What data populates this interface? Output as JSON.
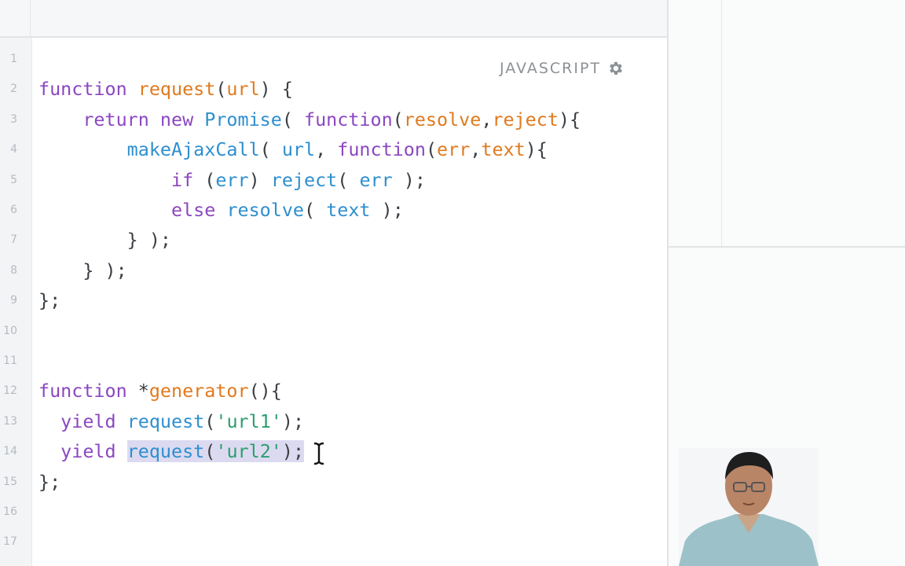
{
  "editor": {
    "language_label": "JAVASCRIPT",
    "settings_icon": "gear-icon",
    "lines": [
      {
        "n": "1",
        "tokens": []
      },
      {
        "n": "2",
        "tokens": [
          {
            "t": "function ",
            "c": "k"
          },
          {
            "t": "request",
            "c": "f"
          },
          {
            "t": "(",
            "c": ""
          },
          {
            "t": "url",
            "c": "f"
          },
          {
            "t": ") {",
            "c": ""
          }
        ]
      },
      {
        "n": "3",
        "tokens": [
          {
            "t": "    return new ",
            "c": "k"
          },
          {
            "t": "Promise",
            "c": "c"
          },
          {
            "t": "( ",
            "c": ""
          },
          {
            "t": "function",
            "c": "k"
          },
          {
            "t": "(",
            "c": ""
          },
          {
            "t": "resolve",
            "c": "f"
          },
          {
            "t": ",",
            "c": ""
          },
          {
            "t": "reject",
            "c": "f"
          },
          {
            "t": "){",
            "c": ""
          }
        ]
      },
      {
        "n": "4",
        "tokens": [
          {
            "t": "        ",
            "c": ""
          },
          {
            "t": "makeAjaxCall",
            "c": "c"
          },
          {
            "t": "( ",
            "c": ""
          },
          {
            "t": "url",
            "c": "c"
          },
          {
            "t": ", ",
            "c": ""
          },
          {
            "t": "function",
            "c": "k"
          },
          {
            "t": "(",
            "c": ""
          },
          {
            "t": "err",
            "c": "f"
          },
          {
            "t": ",",
            "c": ""
          },
          {
            "t": "text",
            "c": "f"
          },
          {
            "t": "){",
            "c": ""
          }
        ]
      },
      {
        "n": "5",
        "tokens": [
          {
            "t": "            ",
            "c": ""
          },
          {
            "t": "if",
            "c": "k"
          },
          {
            "t": " (",
            "c": ""
          },
          {
            "t": "err",
            "c": "c"
          },
          {
            "t": ") ",
            "c": ""
          },
          {
            "t": "reject",
            "c": "c"
          },
          {
            "t": "( ",
            "c": ""
          },
          {
            "t": "err",
            "c": "c"
          },
          {
            "t": " );",
            "c": ""
          }
        ]
      },
      {
        "n": "6",
        "tokens": [
          {
            "t": "            ",
            "c": ""
          },
          {
            "t": "else",
            "c": "k"
          },
          {
            "t": " ",
            "c": ""
          },
          {
            "t": "resolve",
            "c": "c"
          },
          {
            "t": "( ",
            "c": ""
          },
          {
            "t": "text",
            "c": "c"
          },
          {
            "t": " );",
            "c": ""
          }
        ]
      },
      {
        "n": "7",
        "tokens": [
          {
            "t": "        } );",
            "c": ""
          }
        ]
      },
      {
        "n": "8",
        "tokens": [
          {
            "t": "    } );",
            "c": ""
          }
        ]
      },
      {
        "n": "9",
        "tokens": [
          {
            "t": "};",
            "c": ""
          }
        ]
      },
      {
        "n": "10",
        "tokens": []
      },
      {
        "n": "11",
        "tokens": []
      },
      {
        "n": "12",
        "tokens": [
          {
            "t": "function ",
            "c": "k"
          },
          {
            "t": "*",
            "c": ""
          },
          {
            "t": "generator",
            "c": "f"
          },
          {
            "t": "(){",
            "c": ""
          }
        ]
      },
      {
        "n": "13",
        "tokens": [
          {
            "t": "  ",
            "c": ""
          },
          {
            "t": "yield",
            "c": "k"
          },
          {
            "t": " ",
            "c": ""
          },
          {
            "t": "request",
            "c": "c"
          },
          {
            "t": "(",
            "c": ""
          },
          {
            "t": "'url1'",
            "c": "s"
          },
          {
            "t": ");",
            "c": ""
          }
        ]
      },
      {
        "n": "14",
        "tokens": [
          {
            "t": "  ",
            "c": ""
          },
          {
            "t": "yield",
            "c": "k"
          },
          {
            "t": " ",
            "c": ""
          },
          {
            "t": "request",
            "c": "c",
            "sel": true
          },
          {
            "t": "(",
            "c": "",
            "sel": true
          },
          {
            "t": "'url2'",
            "c": "s",
            "sel": true
          },
          {
            "t": ");",
            "c": "",
            "sel": true
          }
        ]
      },
      {
        "n": "15",
        "tokens": [
          {
            "t": "};",
            "c": ""
          }
        ]
      },
      {
        "n": "16",
        "tokens": []
      },
      {
        "n": "17",
        "tokens": []
      }
    ]
  },
  "colors": {
    "keyword": "#8b47c0",
    "function_name": "#e07a1f",
    "call": "#2e8fcf",
    "string": "#2a9e6e",
    "selection": "#dcdaf0"
  },
  "webcam": {
    "icon": "presenter-video-icon"
  }
}
